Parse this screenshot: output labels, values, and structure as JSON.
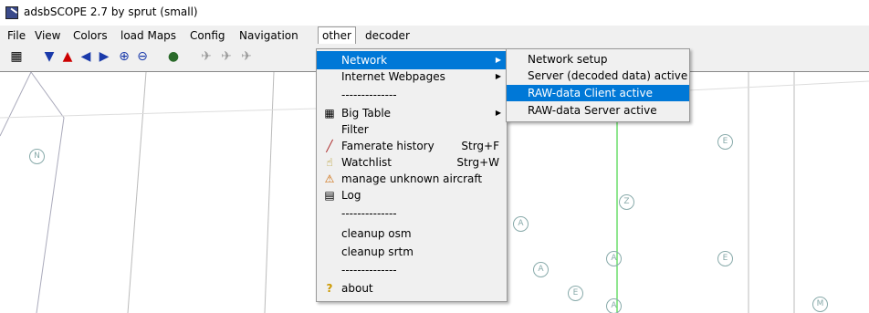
{
  "window": {
    "title": "adsbSCOPE 2.7 by sprut  (small)"
  },
  "menubar": {
    "items": [
      "File",
      "View",
      "Colors",
      "load Maps",
      "Config",
      "Navigation",
      "other",
      "decoder"
    ]
  },
  "toolbar": {
    "icons": [
      "table-icon",
      "arrow-down-icon",
      "arrow-up-icon",
      "arrow-left-icon",
      "arrow-right-icon",
      "zoom-in-icon",
      "zoom-out-icon",
      "globe-icon",
      "aircraft-group-1-icon",
      "aircraft-group-2-icon",
      "aircraft-group-3-icon"
    ]
  },
  "other_menu": {
    "items": [
      {
        "label": "Network",
        "submenu": true,
        "highlighted": true
      },
      {
        "label": "Internet Webpages",
        "submenu": true
      },
      {
        "separator": "--------------"
      },
      {
        "label": "Big Table",
        "submenu": true,
        "icon": "table-icon"
      },
      {
        "label": "Filter"
      },
      {
        "label": "Famerate history",
        "shortcut": "Strg+F",
        "icon": "chart-icon"
      },
      {
        "label": "Watchlist",
        "shortcut": "Strg+W",
        "icon": "hand-icon"
      },
      {
        "label": "manage unknown aircraft",
        "icon": "warning-icon"
      },
      {
        "label": "Log",
        "icon": "log-icon"
      },
      {
        "separator": "--------------"
      },
      {
        "label": "cleanup osm"
      },
      {
        "label": "cleanup srtm"
      },
      {
        "separator": "--------------"
      },
      {
        "label": "about",
        "icon": "question-icon"
      }
    ]
  },
  "network_submenu": {
    "items": [
      {
        "label": "Network setup"
      },
      {
        "label": "Server (decoded data) active"
      },
      {
        "label": "RAW-data Client active",
        "highlighted": true
      },
      {
        "label": "RAW-data Server active"
      }
    ]
  },
  "map": {
    "labels": [
      "N",
      "E",
      "Z",
      "A",
      "A",
      "A",
      "E",
      "E",
      "A",
      "M"
    ]
  },
  "colors": {
    "highlight": "#0078d7",
    "menu_bg": "#f0f0f0",
    "map_bg": "#ffffff"
  }
}
